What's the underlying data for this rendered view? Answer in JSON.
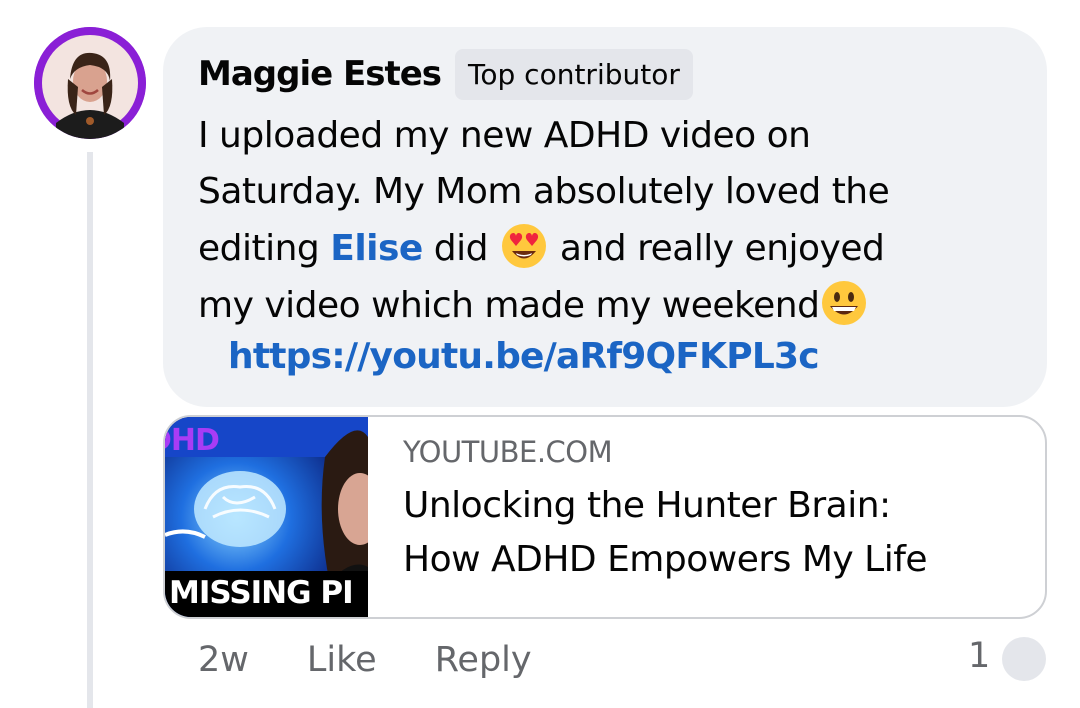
{
  "comment": {
    "author": "Maggie Estes",
    "badge": "Top contributor",
    "text_line1": "I uploaded my new ADHD video on",
    "text_line2": "Saturday. My Mom absolutely loved the",
    "text_line3_pre": "editing ",
    "mention": "Elise",
    "text_line3_mid": " did ",
    "text_line3_post": " and really enjoyed",
    "text_line4": "my video which made my weekend",
    "emoji_1": "heart-eyes-emoji",
    "emoji_2": "grinning-emoji",
    "link": "https://youtu.be/aRf9QFKPL3c"
  },
  "link_preview": {
    "domain": "YOUTUBE.COM",
    "title_line1": "Unlocking the Hunter Brain:",
    "title_line2": "How ADHD Empowers My Life",
    "thumbnail_text_top": "DHD",
    "thumbnail_text_bottom": "MISSING PI"
  },
  "actions": {
    "time": "2w",
    "like": "Like",
    "reply": "Reply",
    "reaction_count": "1"
  },
  "colors": {
    "bubble": "#f0f2f5",
    "link": "#1b65c4",
    "secondary_text": "#65676b",
    "avatar_ring": "#8a1fd6"
  }
}
